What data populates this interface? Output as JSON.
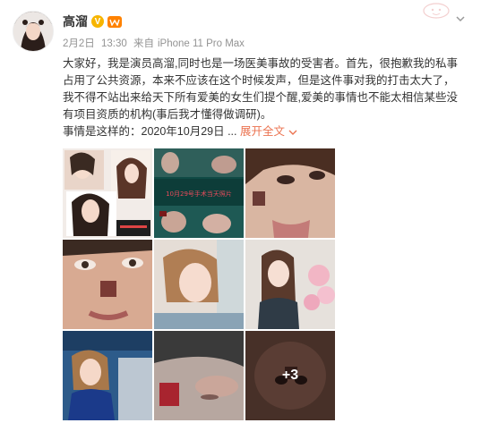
{
  "user": {
    "name": "高溜",
    "verified_icon": "V",
    "level_icon": "vip-icon"
  },
  "meta": {
    "date": "2月2日",
    "time": "13:30",
    "source_prefix": "来自",
    "device": "iPhone 11 Pro Max"
  },
  "post": {
    "lines": [
      "大家好，我是演员高溜,同时也是一场医美事故的受害者。首先，很抱歉我的私事",
      "占用了公共资源，本来不应该在这个时候发声，但是这件事对我的打击太大了，",
      "我不得不站出来给天下所有爱美的女生们提个醒,爱美的事情也不能太相信某些没",
      "有项目资质的机构(事后我才懂得做调研)。"
    ],
    "last_line_prefix": "事情是这样的：2020年10月29日 ...",
    "expand_label": "展开全文",
    "expand_icon": "chevron-down-icon"
  },
  "gallery": {
    "more_label": "+3",
    "thumb2_caption": "10月29号手术当天照片"
  },
  "colors": {
    "link": "#eb7350",
    "meta": "#939393",
    "verified": "#f7b500"
  }
}
